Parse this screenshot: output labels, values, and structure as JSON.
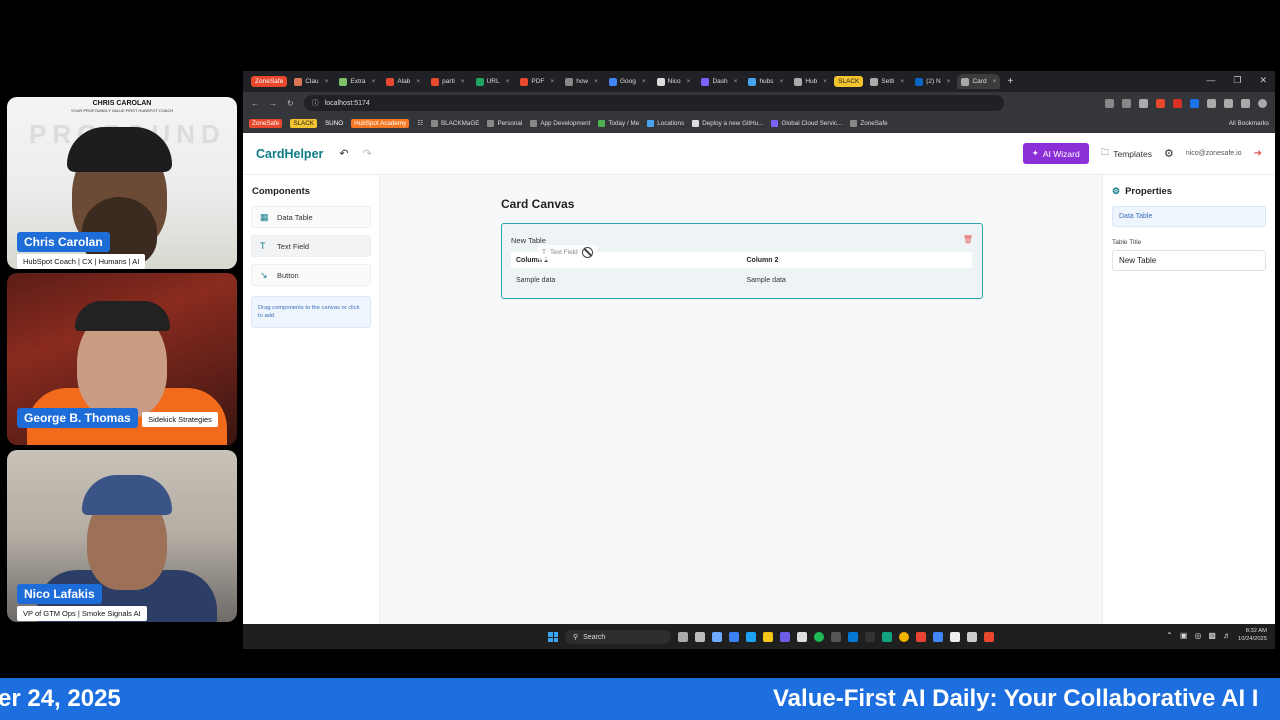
{
  "speakers": [
    {
      "name": "Chris Carolan",
      "title": "HubSpot Coach | CX | Humans | AI",
      "brand_top": "CHRIS CAROLAN",
      "brand_sub": "YOUR PROFOUNDLY VALUE FIRST HUBSPOT COACH",
      "watermark": "PROFOUND"
    },
    {
      "name": "George B. Thomas",
      "title": "Sidekick Strategies"
    },
    {
      "name": "Nico Lafakis",
      "title": "VP of GTM Ops | Smoke Signals AI"
    }
  ],
  "ticker": {
    "left": "er 24, 2025",
    "right": "Value-First AI Daily: Your Collaborative AI I"
  },
  "browser": {
    "tabs": [
      {
        "label": "ZoneSafe",
        "style": "special"
      },
      {
        "label": "Clau",
        "color": "#d97757"
      },
      {
        "label": "Extra",
        "color": "#7ec36b"
      },
      {
        "label": "Alab",
        "color": "#e8482e"
      },
      {
        "label": "parti",
        "color": "#e8482e"
      },
      {
        "label": "URL",
        "color": "#1fa463"
      },
      {
        "label": "PDF",
        "color": "#e8482e"
      },
      {
        "label": "how",
        "color": "#888"
      },
      {
        "label": "Goog",
        "color": "#4285f4"
      },
      {
        "label": "Nico",
        "color": "#ddd"
      },
      {
        "label": "Dash",
        "color": "#7b61ff"
      },
      {
        "label": "hubs",
        "color": "#4aa3f0"
      },
      {
        "label": "Hub",
        "color": "#aaa"
      },
      {
        "label": "SLACK",
        "style": "slack"
      },
      {
        "label": "Setti",
        "color": "#aaa"
      },
      {
        "label": "(2) N",
        "color": "#0a66c2"
      },
      {
        "label": "Card",
        "color": "#aaa",
        "style": "active"
      }
    ],
    "url": "localhost:5174",
    "bookmarks": [
      {
        "label": "ZoneSafe",
        "style": "tag-zone"
      },
      {
        "label": "SLACK",
        "style": "tag-slack"
      },
      {
        "label": "SUNO",
        "style": "tag-suno"
      },
      {
        "label": "HubSpot Academy",
        "style": "tag-hs"
      },
      {
        "label": "BLACKMaGE",
        "color": "#888"
      },
      {
        "label": "Personal",
        "color": "#888"
      },
      {
        "label": "App Development",
        "color": "#888"
      },
      {
        "label": "Today / Me",
        "color": "#4caf50"
      },
      {
        "label": "Locations",
        "color": "#4aa3f0"
      },
      {
        "label": "Deploy a new GitHu...",
        "color": "#ddd"
      },
      {
        "label": "Global Cloud Servic...",
        "color": "#7b61ff"
      },
      {
        "label": "ZoneSafe",
        "color": "#888"
      }
    ],
    "all_bookmarks": "All Bookmarks"
  },
  "app": {
    "logo": "CardHelper",
    "ai_wizard": "AI Wizard",
    "templates": "Templates",
    "user_email": "nico@zonesafe.io",
    "components_title": "Components",
    "components": [
      {
        "label": "Data Table",
        "icon": "table-icon"
      },
      {
        "label": "Text Field",
        "icon": "text-icon"
      },
      {
        "label": "Button",
        "icon": "cursor-icon"
      }
    ],
    "hint": "Drag components to the canvas or click to add",
    "canvas_title": "Card Canvas",
    "card": {
      "title": "New Table",
      "columns": [
        "Column 1",
        "Column 2"
      ],
      "rows": [
        [
          "Sample data",
          "Sample data"
        ]
      ]
    },
    "drag_ghost": "Text Field",
    "properties_title": "Properties",
    "selected_type": "Data Table",
    "table_title_label": "Table Title",
    "table_title_value": "New Table"
  },
  "taskbar": {
    "search": "Search",
    "time": "8:32 AM",
    "date": "10/24/2025"
  },
  "colors": {
    "accent": "#0e7c86",
    "ai_button": "#8b2fd6",
    "ticker": "#1d6fe0"
  }
}
